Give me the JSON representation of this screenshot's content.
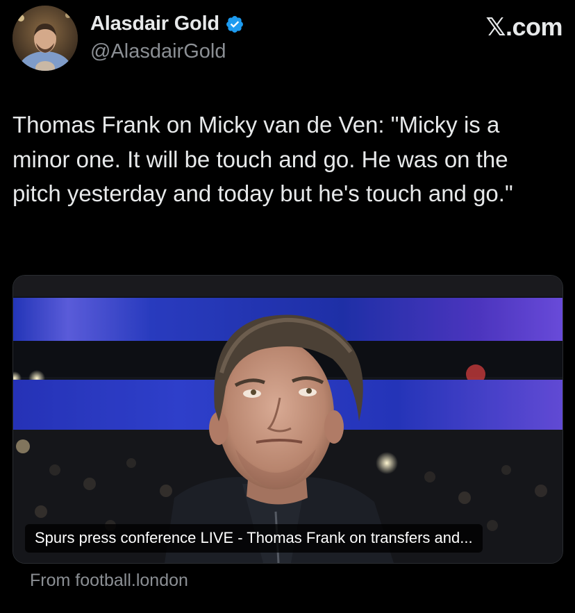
{
  "author": {
    "display_name": "Alasdair Gold",
    "handle": "@AlasdairGold",
    "verified": true,
    "avatar_icon": "profile-photo"
  },
  "site_logo": "𝕏.com",
  "tweet": {
    "text": "Thomas Frank on Micky van de Ven: \"Micky is a minor one. It will be touch and go. He was on the pitch yesterday and today but he's touch and go.\""
  },
  "link_card": {
    "caption": "Spurs press conference LIVE - Thomas Frank on transfers and...",
    "source": "From football.london",
    "image_icon": "stadium-photo"
  },
  "colors": {
    "background": "#000000",
    "text_primary": "#e7e9ea",
    "text_secondary": "#8b8f94",
    "verified_blue": "#1d9bf0"
  }
}
